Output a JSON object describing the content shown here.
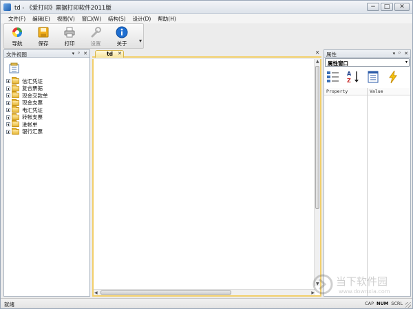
{
  "window": {
    "title": "td - 《爱打印》票据打印软件2011版",
    "controls": {
      "minimize": "−",
      "maximize": "□",
      "close": "✕"
    }
  },
  "menu": {
    "items": [
      "文件(F)",
      "编辑(E)",
      "视图(V)",
      "窗口(W)",
      "结构(S)",
      "设计(D)",
      "帮助(H)"
    ]
  },
  "toolbar": {
    "buttons": [
      {
        "label": "导航",
        "icon": "navigation-icon",
        "enabled": true
      },
      {
        "label": "保存",
        "icon": "save-icon",
        "enabled": true
      },
      {
        "label": "打印",
        "icon": "printer-icon",
        "enabled": true
      },
      {
        "label": "设置",
        "icon": "wrench-icon",
        "enabled": false
      },
      {
        "label": "关于",
        "icon": "info-icon",
        "enabled": true
      }
    ],
    "overflow": "▾"
  },
  "left_panel": {
    "title": "文件视图",
    "header_controls": {
      "dropdown": "▾",
      "pin": "ᵖ",
      "close": "✕"
    },
    "tree": [
      "信汇凭证",
      "复合票据",
      "现金交款单",
      "现金支票",
      "电汇凭证",
      "转帐支票",
      "进帐单",
      "银行汇票"
    ]
  },
  "document": {
    "tab": "td",
    "tab_close": "✕",
    "close": "✕"
  },
  "right_panel": {
    "title": "属性",
    "header_controls": {
      "dropdown": "▾",
      "pin": "ᵖ",
      "close": "✕"
    },
    "object_select": "属性窗口",
    "select_arrow": "▾",
    "columns": {
      "property": "Property",
      "value": "Value"
    }
  },
  "statusbar": {
    "text": "就绪",
    "cap": "CAP",
    "num": "NUM",
    "scrl": "SCRL"
  },
  "watermark": {
    "text": "当下软件园",
    "url": "www.downxia.com"
  }
}
